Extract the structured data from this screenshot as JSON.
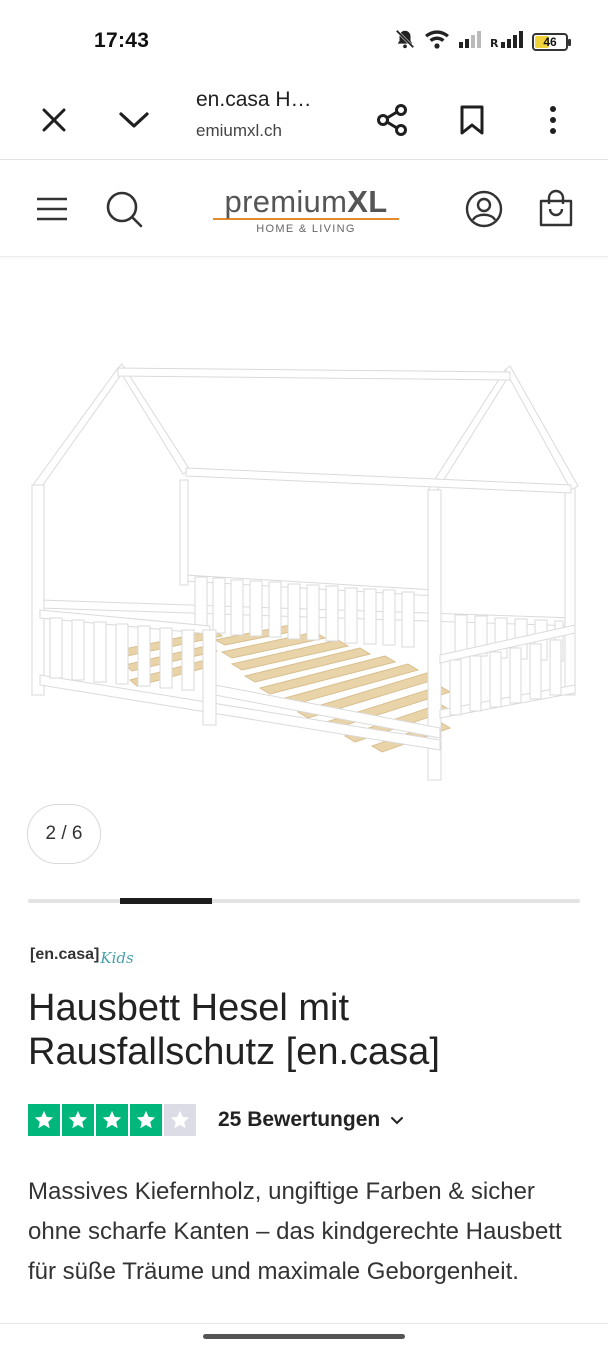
{
  "status_bar": {
    "time": "17:43",
    "battery_level": "46",
    "icons": [
      "mute-icon",
      "wifi-icon",
      "signal-icon",
      "roaming-signal-icon",
      "battery-icon"
    ]
  },
  "browser": {
    "tab_title": "en.casa H…",
    "url_host": "emiumxl.ch",
    "icons": [
      "close-icon",
      "chevron-down-icon",
      "share-icon",
      "bookmark-icon",
      "more-vertical-icon"
    ]
  },
  "site_header": {
    "logo_text_light": "premium",
    "logo_text_bold": "XL",
    "logo_tagline": "HOME & LIVING",
    "icons": [
      "menu-icon",
      "search-icon",
      "account-icon",
      "cart-icon"
    ]
  },
  "gallery": {
    "counter": "2 / 6",
    "current": 2,
    "total": 6
  },
  "product": {
    "brand_main": "[en.casa]",
    "brand_sub": "Kids",
    "title": "Hausbett Hesel mit Rausfallschutz [en.casa]",
    "rating_value": 4,
    "rating_max": 5,
    "reviews_label": "25 Bewertungen",
    "description": "Massives Kiefernholz, ungiftige Farben & sicher ohne scharfe Kanten – das kindgerechte Hausbett für süße Träume und maximale Geborgenheit."
  },
  "colors": {
    "accent_orange": "#e58a2b",
    "rating_green": "#00b67a",
    "rating_grey": "#dcdce6",
    "battery_yellow": "#f2d23b"
  }
}
